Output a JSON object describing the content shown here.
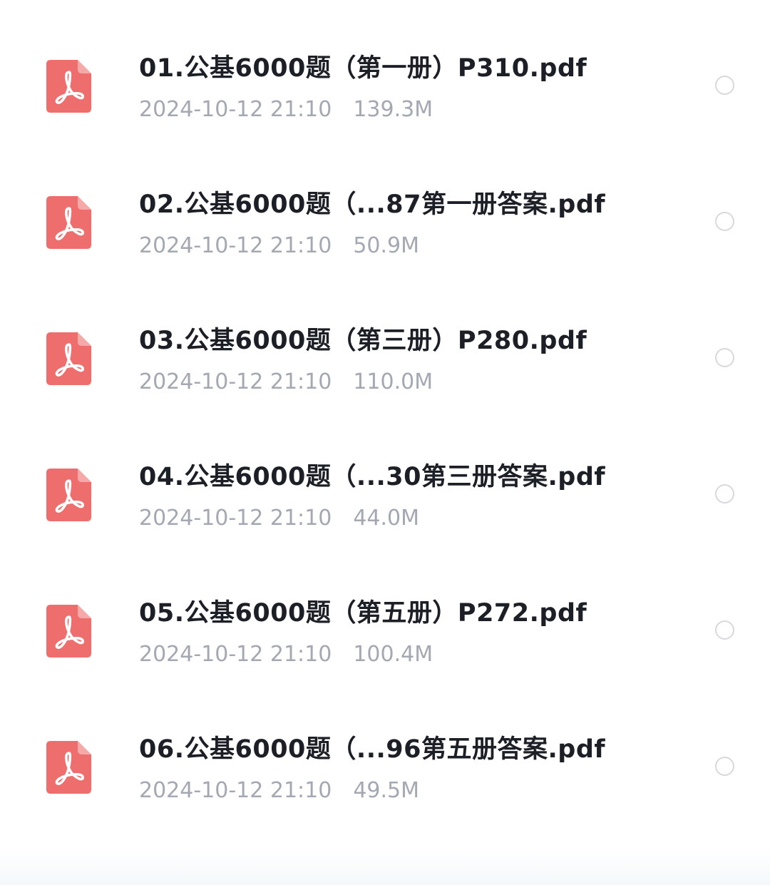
{
  "files": [
    {
      "name": "01.公基6000题（第一册）P310.pdf",
      "date": "2024-10-12 21:10",
      "size": "139.3M",
      "icon": "pdf-icon",
      "selected": false
    },
    {
      "name": "02.公基6000题（...87第一册答案.pdf",
      "date": "2024-10-12 21:10",
      "size": "50.9M",
      "icon": "pdf-icon",
      "selected": false
    },
    {
      "name": "03.公基6000题（第三册）P280.pdf",
      "date": "2024-10-12 21:10",
      "size": "110.0M",
      "icon": "pdf-icon",
      "selected": false
    },
    {
      "name": "04.公基6000题（...30第三册答案.pdf",
      "date": "2024-10-12 21:10",
      "size": "44.0M",
      "icon": "pdf-icon",
      "selected": false
    },
    {
      "name": "05.公基6000题（第五册）P272.pdf",
      "date": "2024-10-12 21:10",
      "size": "100.4M",
      "icon": "pdf-icon",
      "selected": false
    },
    {
      "name": "06.公基6000题（...96第五册答案.pdf",
      "date": "2024-10-12 21:10",
      "size": "49.5M",
      "icon": "pdf-icon",
      "selected": false
    }
  ],
  "colors": {
    "pdf_icon": "#ee6e6e",
    "title_text": "#1c1f26",
    "meta_text": "#a3a8b2",
    "radio_border": "#d7d9dd"
  }
}
